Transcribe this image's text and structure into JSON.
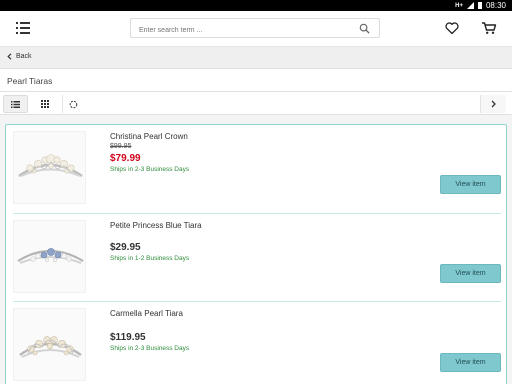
{
  "status_bar": {
    "network": "H+",
    "time": "08:30"
  },
  "search": {
    "placeholder": "Enter search term ..."
  },
  "nav": {
    "back_label": "Back"
  },
  "page_title": "Pearl Tiaras",
  "toolbar": {
    "active_view": "list"
  },
  "accent_color": "#7fc8cd",
  "sale_price_color": "#d0021b",
  "shipping_text_color": "#2e8b3a",
  "products": [
    {
      "name": "Christina Pearl Crown",
      "old_price": "$99.95",
      "price": "$79.99",
      "shipping": "Ships in 2-3 Business Days",
      "button_label": "View item",
      "gem_color": "#f2eee2"
    },
    {
      "name": "Petite Princess Blue Tiara",
      "price": "$29.95",
      "shipping": "Ships in 1-2 Business Days",
      "button_label": "View item",
      "gem_color": "#8fa3c8"
    },
    {
      "name": "Carmella Pearl Tiara",
      "price": "$119.95",
      "shipping": "Ships in 2-3 Business Days",
      "button_label": "View item",
      "gem_color": "#efe6d3"
    }
  ]
}
